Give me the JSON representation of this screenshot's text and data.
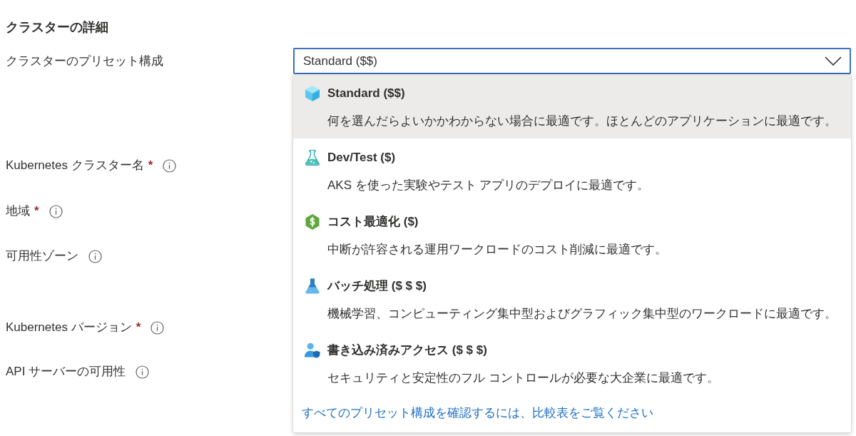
{
  "section_title": "クラスターの詳細",
  "preset": {
    "label": "クラスターのプリセット構成",
    "value": "Standard ($$)",
    "expanded": true,
    "options": [
      {
        "title": "Standard ($$)",
        "description": "何を選んだらよいかかわからない場合に最適です。ほとんどのアプリケーションに最適です。",
        "selected": true
      },
      {
        "title": "Dev/Test ($)",
        "description": "AKS を使った実験やテスト アプリのデプロイに最適です。",
        "selected": false
      },
      {
        "title": "コスト最適化 ($)",
        "description": "中断が許容される運用ワークロードのコスト削減に最適です。",
        "selected": false
      },
      {
        "title": "バッチ処理 ($ $ $)",
        "description": "機械学習、コンピューティング集中型およびグラフィック集中型のワークロードに最適です。",
        "selected": false
      },
      {
        "title": "書き込み済みアクセス ($ $ $)",
        "description": "セキュリティと安定性のフル コントロールが必要な大企業に最適です。",
        "selected": false
      }
    ],
    "link": "すべてのプリセット構成を確認するには、比較表をご覧ください"
  },
  "fields": [
    {
      "label": "Kubernetes クラスター名",
      "required_mark": "*",
      "info": true
    },
    {
      "label": "地域",
      "required_mark": "*",
      "info": true
    },
    {
      "label": "可用性ゾーン",
      "info": true
    },
    {
      "label": "Kubernetes バージョン",
      "required_mark": "*",
      "info": true
    },
    {
      "label": "API サーバーの可用性",
      "info": true
    }
  ]
}
